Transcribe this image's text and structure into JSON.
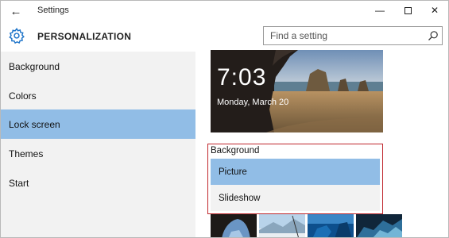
{
  "window": {
    "title": "Settings",
    "back_icon": "back-arrow-icon",
    "controls": [
      "minimize-icon",
      "maximize-icon",
      "close-icon"
    ]
  },
  "header": {
    "title": "PERSONALIZATION",
    "icon": "gear-icon",
    "search": {
      "placeholder": "Find a setting",
      "value": ""
    }
  },
  "sidebar": {
    "items": [
      {
        "label": "Background",
        "selected": false
      },
      {
        "label": "Colors",
        "selected": false
      },
      {
        "label": "Lock screen",
        "selected": true
      },
      {
        "label": "Themes",
        "selected": false
      },
      {
        "label": "Start",
        "selected": false
      }
    ]
  },
  "preview": {
    "time": "7:03",
    "date": "Monday, March 20"
  },
  "background": {
    "label": "Background",
    "options": [
      {
        "label": "Picture",
        "selected": true
      },
      {
        "label": "Slideshow",
        "selected": false
      }
    ]
  },
  "colors": {
    "selection": "#91bde6",
    "sidebar_bg": "#f2f2f2",
    "highlight_border": "#c0272d"
  }
}
